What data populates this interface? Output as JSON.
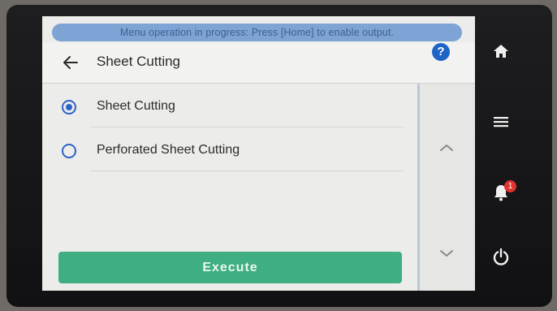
{
  "banner": {
    "text": "Menu operation in progress: Press [Home] to enable output."
  },
  "header": {
    "title": "Sheet Cutting",
    "help_icon": "question-circle-icon",
    "help_glyph": "?"
  },
  "options": [
    {
      "label": "Sheet Cutting",
      "selected": true
    },
    {
      "label": "Perforated Sheet Cutting",
      "selected": false
    }
  ],
  "actions": {
    "execute_label": "Execute"
  },
  "sidebar": {
    "notification_count": "1",
    "icons": [
      "home-icon",
      "menu-icon",
      "bell-icon",
      "power-icon"
    ]
  },
  "colors": {
    "accent_blue": "#2d63c7",
    "execute_green": "#3fae82",
    "banner_blue": "#7ea4d6",
    "badge_red": "#e2342f"
  }
}
